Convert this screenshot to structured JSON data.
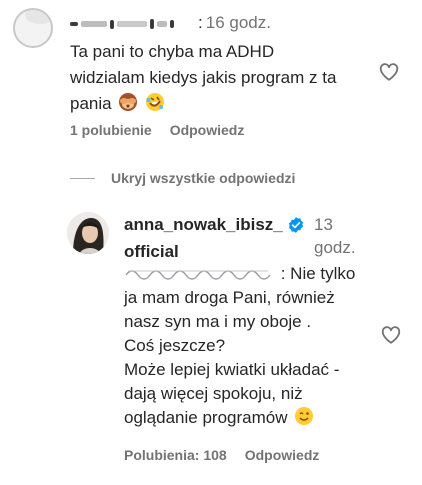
{
  "top_comment": {
    "time": "16 godz.",
    "text_lines": [
      "Ta pani to chyba ma ADHD",
      "widzialam kiedys jakis program z ta",
      "pania"
    ],
    "emojis": [
      "see-no-evil-monkey",
      "rolling-on-floor-laughing"
    ],
    "likes": "1 polubienie",
    "reply_label": "Odpowiedz"
  },
  "hide_replies_label": "Ukryj wszystkie odpowiedzi",
  "reply": {
    "username_line1": "anna_nowak_ibisz_",
    "username_line2": "official",
    "time_line1": "13",
    "time_line2": "godz.",
    "text_first_line": ": Nie tylko",
    "text_lines": [
      "ja mam droga Pani, również",
      "nasz syn ma i my oboje .",
      "Coś jeszcze?",
      "Może lepiej kwiatki układać -",
      "dają więcej spokoju, niż",
      "oglądanie programów"
    ],
    "emoji": "winking-smile",
    "likes": "Polubienia: 108",
    "reply_label": "Odpowiedz"
  },
  "colors": {
    "text": "#262626",
    "secondary": "#737373",
    "verified": "#0095f6"
  }
}
